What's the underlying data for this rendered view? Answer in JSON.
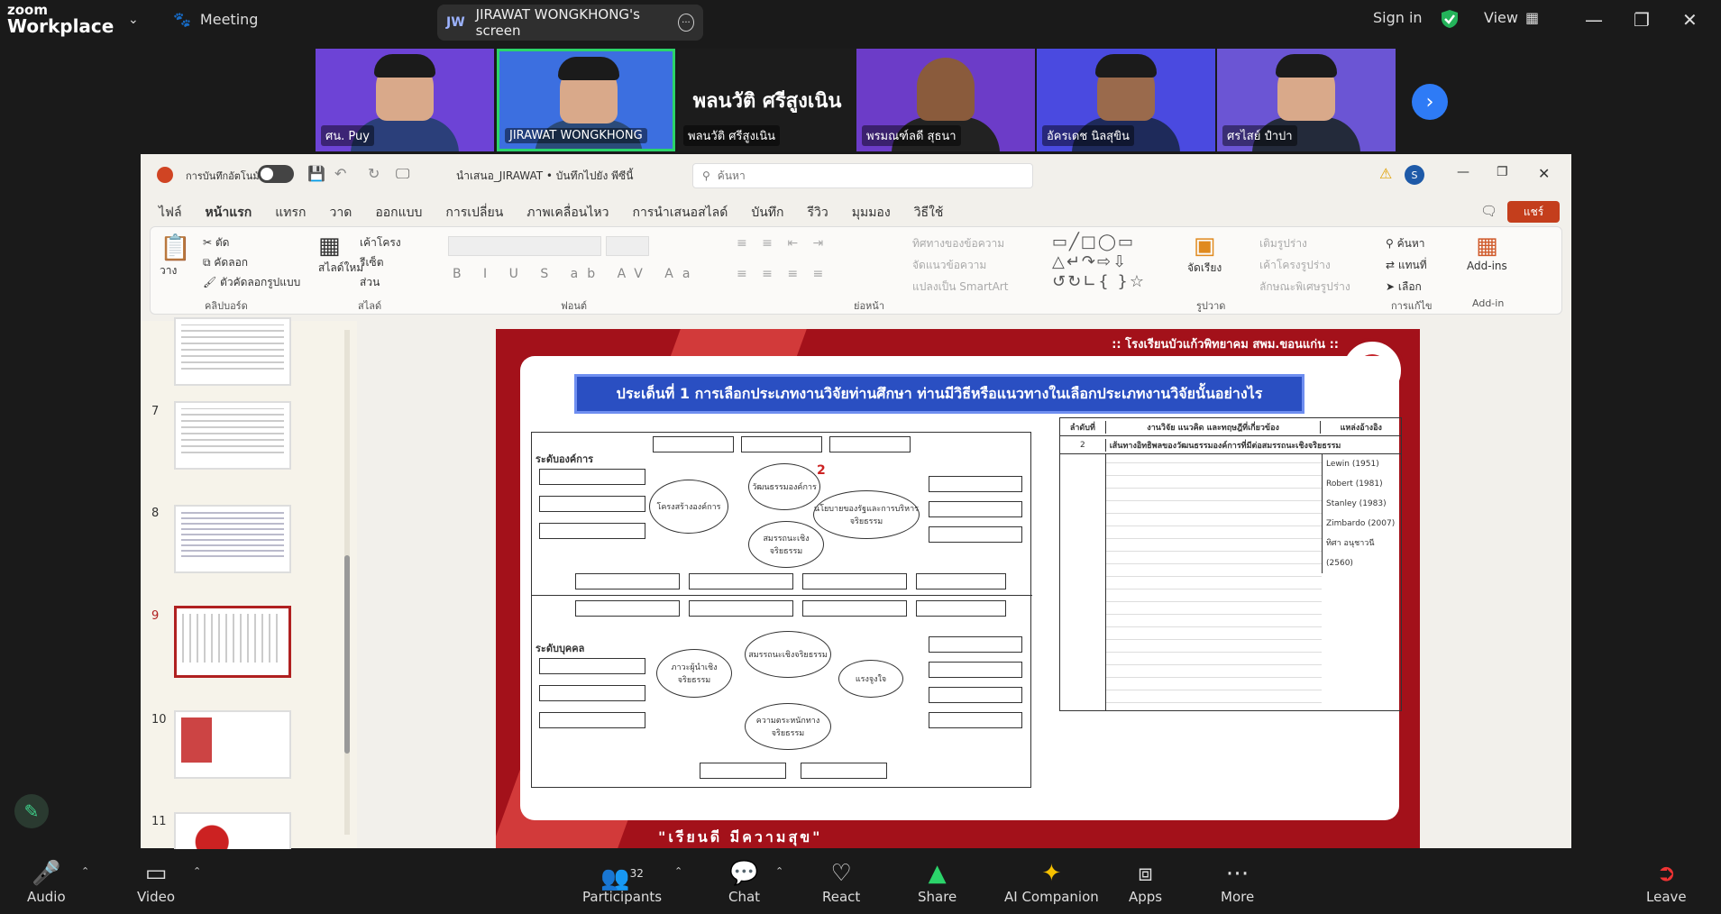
{
  "app": {
    "brand_small": "zoom",
    "brand_big": "Workplace",
    "meeting_label": "Meeting",
    "share_initials": "JW",
    "share_label": "JIRAWAT WONGKHONG's screen",
    "sign_in": "Sign in",
    "view_label": "View"
  },
  "participants": [
    {
      "name": "ศน. Puy",
      "bg": "#6d43d6"
    },
    {
      "name": "JIRAWAT WONGKHONG",
      "bg": "#3c6fe0"
    },
    {
      "name": "พลนวัติ ศรีสูงเนิน",
      "bg": "#1c1c1c",
      "big": "พลนวัติ ศรีสูงเนิน"
    },
    {
      "name": "พรมณฑ์ลดี สุธนา",
      "bg": "#6c3cc8"
    },
    {
      "name": "อัครเดช นิลสุขิน",
      "bg": "#4a4ae0"
    },
    {
      "name": "ศรไสย์ ปำปา",
      "bg": "#6b55d4"
    }
  ],
  "ppt": {
    "autosave": "การบันทึกอัตโนมัติ",
    "file": "นำเสนอ_JIRAWAT • บันทึกไปยัง พีซีนี้",
    "search": "ค้นหา",
    "avatar": "S",
    "menu": [
      "ไฟล์",
      "หน้าแรก",
      "แทรก",
      "วาด",
      "ออกแบบ",
      "การเปลี่ยน",
      "ภาพเคลื่อนไหว",
      "การนำเสนอสไลด์",
      "บันทึก",
      "รีวิว",
      "มุมมอง",
      "วิธีใช้"
    ],
    "menu_active": 1,
    "share": "แชร์",
    "ribbon": {
      "paste": "วาง",
      "cut": "ตัด",
      "copy": "คัดลอก",
      "format": "ตัวคัดลอกรูปแบบ",
      "clipboard": "คลิปบอร์ด",
      "new_slide": "สไลด์ใหม่",
      "layout": "เค้าโครง",
      "reset": "รีเซ็ต",
      "section": "ส่วน",
      "slides": "สไลด์",
      "font": "ฟอนต์",
      "paragraph": "ย่อหน้า",
      "text_dir": "ทิศทางของข้อความ",
      "align_text": "จัดแนวข้อความ",
      "smartart": "แปลงเป็น SmartArt",
      "arrange": "จัดเรียง",
      "fill": "เติมรูปร่าง",
      "outline": "เค้าโครงรูปร่าง",
      "effects": "ลักษณะพิเศษรูปร่าง",
      "drawing": "รูปวาด",
      "find": "ค้นหา",
      "replace": "แทนที่",
      "select": "เลือก",
      "editing": "การแก้ไข",
      "addins": "Add-ins",
      "addin_group": "Add-in"
    },
    "slide_numbers": [
      "7",
      "8",
      "9",
      "10",
      "11"
    ],
    "slide": {
      "school": ":: โรงเรียนบัวแก้วพิทยาคม สพม.ขอนแก่น ::",
      "title": "ประเด็นที่ 1 การเลือกประเภทงานวิจัยท่านศึกษา ท่านมีวิธีหรือแนวทางในเลือกประเภทงานวิจัยนั้นอย่างไร",
      "slogan": "\"เรียนดี มีความสุข\"",
      "org_level": "ระดับองค์การ",
      "person_level": "ระดับบุคคล",
      "num": "2",
      "ov": [
        "โครงสร้างองค์การ",
        "วัฒนธรรมองค์การ",
        "นโยบายของรัฐและการบริหารจริยธรรม",
        "สมรรถนะเชิงจริยธรรม",
        "สมรรถนะเชิงจริยธรรม",
        "ภาวะผู้นำเชิงจริยธรรม",
        "แรงจูงใจ",
        "ความตระหนักทางจริยธรรม"
      ],
      "table": {
        "h1": "ลำดับที่",
        "h2": "งานวิจัย แนวคิด และทฤษฎีที่เกี่ยวข้อง",
        "h3": "แหล่งอ้างอิง",
        "r1": "2",
        "r1b": "เส้นทางอิทธิพลของวัฒนธรรมองค์การที่มีต่อสมรรถนะเชิงจริยธรรม",
        "refs": [
          "Lewin (1951)",
          "Robert (1981)",
          "Stanley (1983)",
          "Zimbardo (2007)",
          "ทิศา อนุชาวนี (2560)"
        ]
      }
    }
  },
  "toolbar": {
    "audio": "Audio",
    "video": "Video",
    "participants": "Participants",
    "participant_count": "32",
    "chat": "Chat",
    "react": "React",
    "share": "Share",
    "ai": "AI Companion",
    "apps": "Apps",
    "more": "More",
    "leave": "Leave"
  }
}
